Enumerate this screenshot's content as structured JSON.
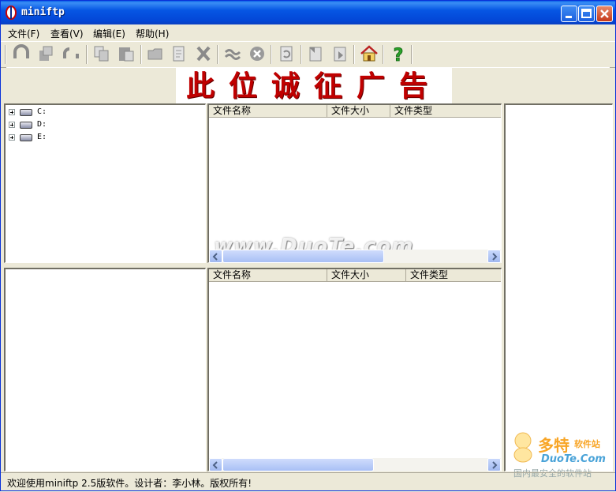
{
  "window": {
    "title": "miniftp"
  },
  "menu": {
    "items": [
      "文件(F)",
      "查看(V)",
      "编辑(E)",
      "帮助(H)"
    ]
  },
  "toolbar": {
    "icons": [
      "connect-icon",
      "connect-properties-icon",
      "disconnect-icon",
      "copy-icon",
      "paste-icon",
      "new-folder-icon",
      "rename-icon",
      "delete-icon",
      "transfer-icon",
      "stop-icon",
      "refresh-icon",
      "upload-icon",
      "download-icon",
      "home-icon",
      "help-icon"
    ]
  },
  "banner": {
    "text": "此位诚征广告"
  },
  "tree": {
    "drives": [
      "C:",
      "D:",
      "E:"
    ]
  },
  "remote_list": {
    "columns": [
      "文件名称",
      "文件大小",
      "文件类型"
    ]
  },
  "local_list": {
    "columns": [
      "文件名称",
      "文件大小",
      "文件类型"
    ]
  },
  "watermark": {
    "text": "www.DuoTe.com"
  },
  "logo": {
    "big": "多特",
    "sub": "软件站",
    "url": "DuoTe.Com",
    "tag": "国内最安全的软件站"
  },
  "status": {
    "text": "欢迎使用miniftp 2.5版软件。设计者：李小林。版权所有!"
  },
  "colors": {
    "titlebar": "#0054e3",
    "banner_text": "#c00000",
    "help": "#2aa32a"
  }
}
